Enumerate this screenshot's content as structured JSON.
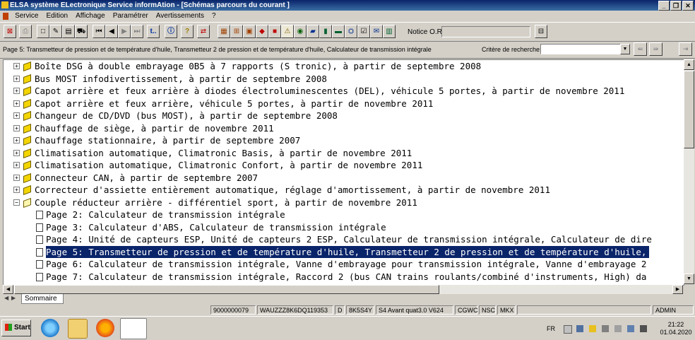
{
  "window": {
    "title": "ELSA système ELectronique Service informAtion - [Schémas parcours du courant ]"
  },
  "menu": [
    "Service",
    "Edition",
    "Affichage",
    "Paramétrer",
    "Avertissements",
    "?"
  ],
  "toolbar": {
    "notice_label": "Notice O.R.:",
    "notice_value": "",
    "nav_label": "t.."
  },
  "infobar": {
    "page_info": "Page 5: Transmetteur de pression et de température d'huile, Transmetteur 2 de pression et de température d'huile, Calculateur de transmission intégrale",
    "criteria_label": "Critère de recherche:",
    "criteria_value": ""
  },
  "tree": {
    "items": [
      "Boîte DSG à double embrayage 0B5 à 7 rapports (S tronic), à partir de septembre 2008",
      "Bus MOST infodivertissement, à partir de septembre 2008",
      "Capot arrière et feux arrière à diodes électroluminescentes (DEL), véhicule 5 portes, à partir de novembre 2011",
      "Capot arrière et feux arrière, véhicule 5 portes, à partir de novembre 2011",
      "Changeur de CD/DVD (bus MOST), à partir de septembre 2008",
      "Chauffage de siège, à partir de novembre 2011",
      "Chauffage stationnaire, à partir de septembre 2007",
      "Climatisation automatique, Climatronic Basis, à partir de novembre 2011",
      "Climatisation automatique, Climatronic Confort, à partir de novembre 2011",
      "Connecteur CAN, à partir de septembre 2007",
      "Correcteur d'assiette entièrement automatique, réglage d'amortissement, à partir de novembre 2011",
      "Couple réducteur arrière - différentiel sport, à partir de novembre 2011"
    ],
    "pages": [
      "Page 2: Calculateur de transmission intégrale",
      "Page 3: Calculateur d'ABS, Calculateur de transmission intégrale",
      "Page 4: Unité de capteurs ESP, Unité de capteurs 2 ESP, Calculateur de transmission intégrale, Calculateur de dire",
      "Page 5: Transmetteur de pression et de température d'huile, Transmetteur 2 de pression et de température d'huile,",
      "Page 6: Calculateur de transmission intégrale, Vanne d'embrayage pour transmission intégrale, Vanne d'embrayage 2",
      "Page 7: Calculateur de transmission intégrale, Raccord 2 (bus CAN trains roulants/combiné d'instruments, High) da"
    ],
    "selected_page": 3
  },
  "tab": {
    "label": "Sommaire"
  },
  "status": {
    "order": "9000000079",
    "vin": "WAUZZZ8K6DQ119353",
    "d": "D",
    "type": "8K5S4Y",
    "model": "S4 Avant quat3.0 V624",
    "engine": "CGWC",
    "code1": "NSC",
    "code2": "MKX",
    "user": "ADMIN"
  },
  "taskbar": {
    "start_label": "Start",
    "lang": "FR",
    "time": "21:22",
    "date": "01.04.2020"
  },
  "colors": {
    "selection": "#0a246a",
    "title_bar": "#0a246a",
    "book": "#f3d500"
  }
}
